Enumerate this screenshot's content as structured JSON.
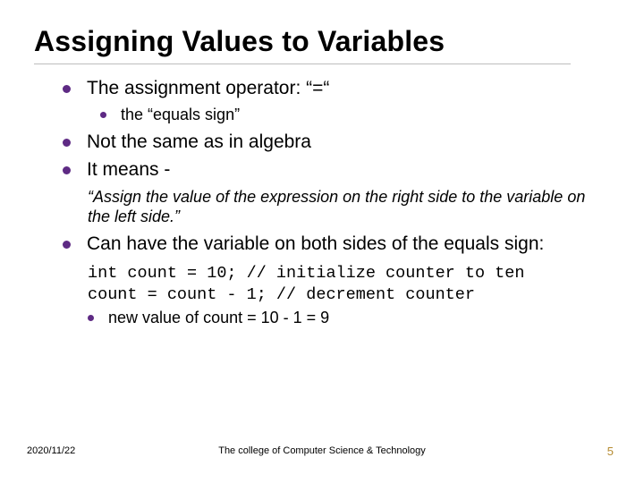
{
  "title": "Assigning Values to Variables",
  "b1": {
    "text": "The assignment operator: “=“"
  },
  "b1s1": {
    "text": "the “equals sign”"
  },
  "b2": {
    "text": "Not the same as in algebra"
  },
  "b3": {
    "text": "It means -"
  },
  "quote": "“Assign the value of the expression on the right side to the variable on the left side.”",
  "b4": {
    "text": "Can have the variable on both sides of the equals sign:"
  },
  "code_line1": "int count = 10; // initialize counter to ten",
  "code_line2": "count = count - 1; // decrement counter",
  "b4s1": {
    "text": "new value of count = 10 - 1 = 9"
  },
  "footer": {
    "date": "2020/11/22",
    "center": "The college of Computer Science & Technology",
    "page": "5"
  }
}
